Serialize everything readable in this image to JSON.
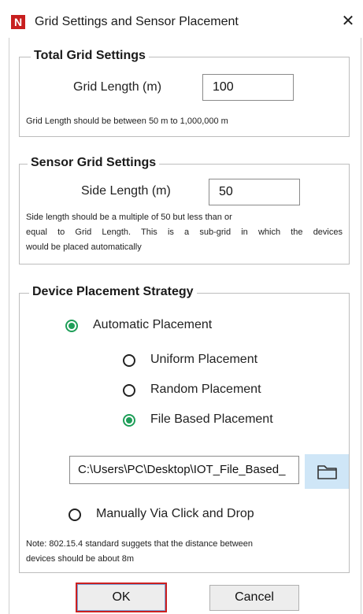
{
  "window": {
    "title": "Grid Settings and Sensor Placement",
    "app_icon": "N",
    "close_glyph": "✕"
  },
  "total_grid": {
    "legend": "Total Grid Settings",
    "grid_length_label": "Grid Length (m)",
    "grid_length_value": "100",
    "note": "Grid Length should be between 50 m to 1,000,000 m"
  },
  "sensor_grid": {
    "legend": "Sensor Grid Settings",
    "side_length_label": "Side Length (m)",
    "side_length_value": "50",
    "note_line1": "Side length should be a multiple of 50 but less than or",
    "note_line2": "equal to Grid Length. This is a sub-grid in which the devices",
    "note_line3": "would be placed automatically"
  },
  "placement": {
    "legend": "Device Placement Strategy",
    "automatic_label": "Automatic Placement",
    "uniform_label": "Uniform Placement",
    "random_label": "Random Placement",
    "file_label": "File Based Placement",
    "file_path": "C:\\Users\\PC\\Desktop\\IOT_File_Based_",
    "manual_label": "Manually Via Click and Drop",
    "note_line1": "Note: 802.15.4 standard suggets that the distance between",
    "note_line2": "devices should be about 8m",
    "selected_mode": "Automatic Placement",
    "selected_auto_option": "File Based Placement"
  },
  "buttons": {
    "ok": "OK",
    "cancel": "Cancel"
  },
  "colors": {
    "accent_radio": "#1e9e58",
    "ok_border": "#cc2020"
  }
}
